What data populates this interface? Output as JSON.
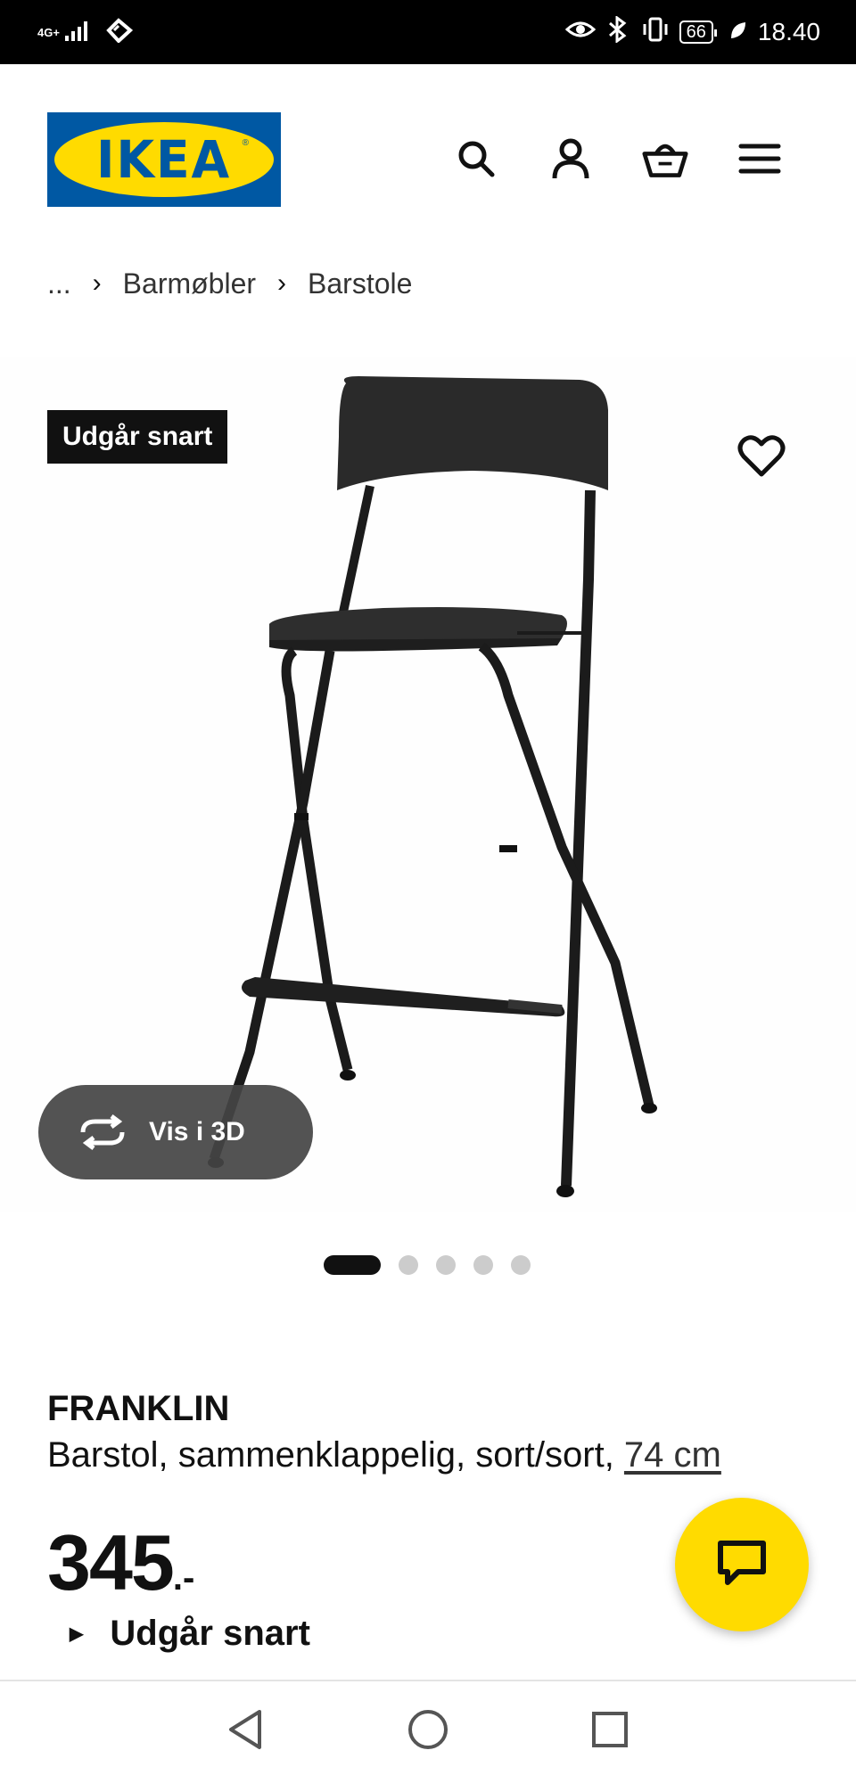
{
  "status_bar": {
    "network": "4G+",
    "battery_level": "66",
    "time": "18.40",
    "icons": [
      "signal-icon",
      "wifi-icon",
      "eye-comfort-icon",
      "bluetooth-icon",
      "vibrate-icon",
      "battery-icon",
      "leaf-icon"
    ]
  },
  "header": {
    "logo_text": "IKEA",
    "logo_reg": "®",
    "icons": [
      "search-icon",
      "user-icon",
      "basket-icon",
      "menu-icon"
    ]
  },
  "breadcrumb": {
    "ellipsis": "...",
    "items": [
      "Barmøbler",
      "Barstole"
    ]
  },
  "product_media": {
    "badge": "Udgår snart",
    "view_3d_label": "Vis i 3D",
    "carousel_count": 5,
    "active_index": 0
  },
  "product": {
    "name": "FRANKLIN",
    "description": "Barstol, sammenklappelig, sort/sort, ",
    "measure": "74 cm",
    "price_integer": "345",
    "price_decimal": ".-",
    "availability": "Udgår snart"
  },
  "colors": {
    "brand_blue": "#0058a3",
    "brand_yellow": "#ffdb00",
    "text": "#111111"
  }
}
